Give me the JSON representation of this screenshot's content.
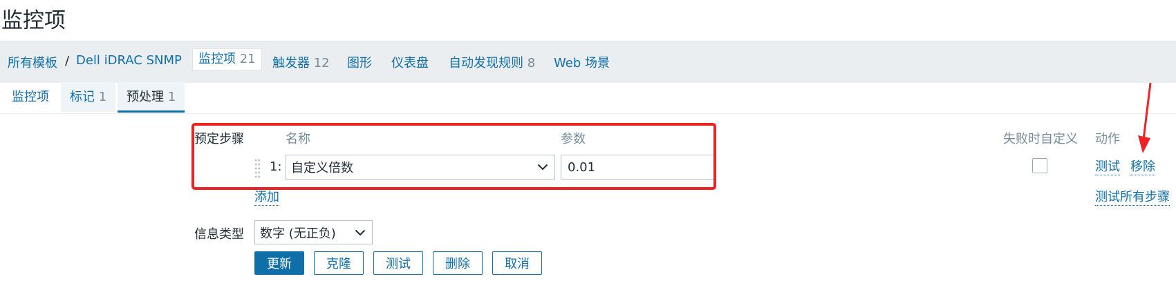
{
  "page": {
    "title": "监控项"
  },
  "breadcrumb": {
    "all_templates": "所有模板",
    "separator": "/",
    "template": "Dell iDRAC SNMP",
    "items": {
      "label": "监控项",
      "count": "21"
    },
    "triggers": {
      "label": "触发器",
      "count": "12"
    },
    "graphs": {
      "label": "图形"
    },
    "dashboards": {
      "label": "仪表盘"
    },
    "discovery": {
      "label": "自动发现规则",
      "count": "8"
    },
    "web": {
      "label": "Web 场景"
    }
  },
  "tabs": [
    {
      "label": "监控项",
      "count": ""
    },
    {
      "label": "标记",
      "count": "1"
    },
    {
      "label": "预处理",
      "count": "1"
    }
  ],
  "preprocessing": {
    "section_label": "预定步骤",
    "columns": {
      "name": "名称",
      "params": "参数",
      "custom_on_fail": "失败时自定义",
      "actions": "动作"
    },
    "steps": [
      {
        "index": "1:",
        "name": "自定义倍数",
        "param": "0.01",
        "custom_on_fail": false,
        "test_label": "测试",
        "remove_label": "移除"
      }
    ],
    "add_label": "添加",
    "test_all_label": "测试所有步骤"
  },
  "info_type": {
    "label": "信息类型",
    "value": "数字 (无正负)"
  },
  "buttons": {
    "update": "更新",
    "clone": "克隆",
    "test": "测试",
    "delete": "删除",
    "cancel": "取消"
  },
  "colors": {
    "link": "#0f6fa8",
    "highlight": "#ee2222",
    "header_bg": "#ebeef0"
  },
  "icons": {
    "dropdown": "chevron-down-icon",
    "drag": "drag-handle-icon",
    "annotation": "arrow-down-icon"
  }
}
